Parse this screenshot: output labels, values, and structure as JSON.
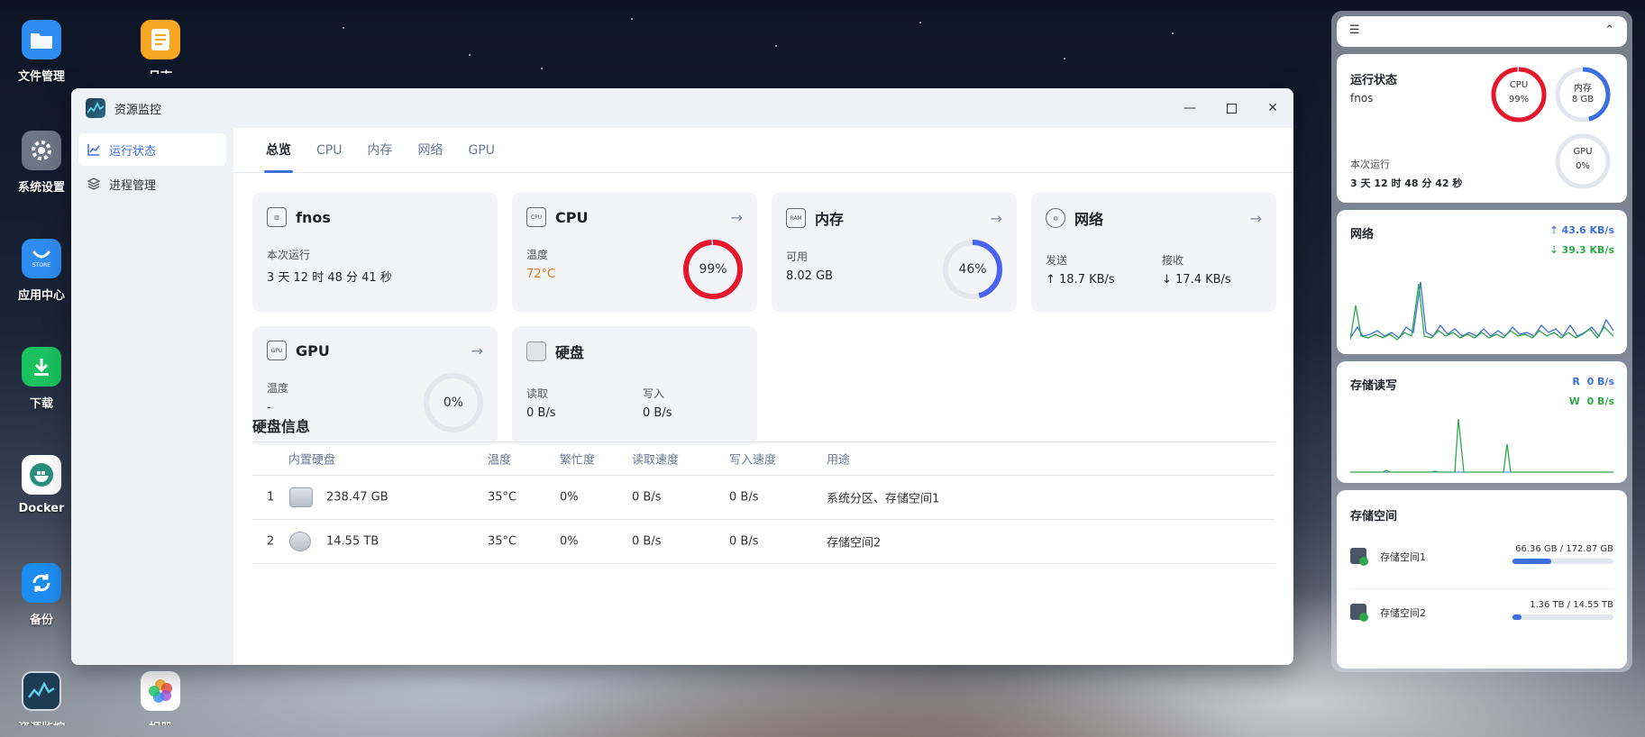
{
  "desktop": {
    "icons": [
      {
        "label": "文件管理",
        "icon": "folder-icon",
        "color": "#2f8cf0"
      },
      {
        "label": "日志",
        "icon": "log-icon",
        "color": "#f6a623"
      },
      {
        "label": "系统设置",
        "icon": "gear-icon",
        "color": "#6d7686"
      },
      {
        "label": "应用中心",
        "icon": "store-icon",
        "color": "#2f8cf0"
      },
      {
        "label": "下载",
        "icon": "download-icon",
        "color": "#19c25f"
      },
      {
        "label": "Docker",
        "icon": "docker-icon",
        "color": "#ffffff"
      },
      {
        "label": "备份",
        "icon": "backup-icon",
        "color": "#1d8cf0"
      },
      {
        "label": "资源监控",
        "icon": "monitor-icon",
        "color": "#1d3b52"
      },
      {
        "label": "相册",
        "icon": "photos-icon",
        "color": "#ffffff"
      }
    ]
  },
  "window": {
    "title": "资源监控",
    "sidebar": [
      {
        "label": "运行状态",
        "icon": "chart-line-icon",
        "active": true
      },
      {
        "label": "进程管理",
        "icon": "layers-icon",
        "active": false
      }
    ],
    "tabs": [
      "总览",
      "CPU",
      "内存",
      "网络",
      "GPU"
    ],
    "active_tab": "总览",
    "cards": {
      "host": {
        "title": "fnos",
        "uptime_label": "本次运行",
        "uptime": "3 天 12 时 48 分 41 秒"
      },
      "cpu": {
        "title": "CPU",
        "temp_label": "温度",
        "temp": "72°C",
        "usage_pct": 99,
        "usage_text": "99%",
        "temp_color": "#e8741a",
        "ring_color": "#e6162d"
      },
      "memory": {
        "title": "内存",
        "avail_label": "可用",
        "avail": "8.02 GB",
        "usage_pct": 46,
        "usage_text": "46%",
        "ring_color": "#4b64f0"
      },
      "network": {
        "title": "网络",
        "send_label": "发送",
        "send": "↑ 18.7 KB/s",
        "recv_label": "接收",
        "recv": "↓ 17.4 KB/s"
      },
      "gpu": {
        "title": "GPU",
        "temp_label": "温度",
        "temp": "-",
        "usage_pct": 0,
        "usage_text": "0%"
      },
      "disk": {
        "title": "硬盘",
        "read_label": "读取",
        "read": "0 B/s",
        "write_label": "写入",
        "write": "0 B/s"
      }
    },
    "disk_info": {
      "title": "硬盘信息",
      "columns": [
        "内置硬盘",
        "温度",
        "繁忙度",
        "读取速度",
        "写入速度",
        "用途"
      ],
      "rows": [
        {
          "index": "1",
          "size": "238.47 GB",
          "temp": "35°C",
          "busy": "0%",
          "read": "0 B/s",
          "write": "0 B/s",
          "usage": "系统分区、存储空间1"
        },
        {
          "index": "2",
          "size": "14.55 TB",
          "temp": "35°C",
          "busy": "0%",
          "read": "0 B/s",
          "write": "0 B/s",
          "usage": "存储空间2"
        }
      ]
    }
  },
  "widgets": {
    "status": {
      "title": "运行状态",
      "host": "fnos",
      "uptime_label": "本次运行",
      "uptime": "3 天 12 时 48 分 42 秒",
      "cpu": {
        "label": "CPU",
        "value": "99%",
        "pct": 99
      },
      "memory": {
        "label": "内存",
        "value": "8 GB",
        "pct": 46
      },
      "gpu": {
        "label": "GPU",
        "value": "0%",
        "pct": 0
      }
    },
    "network": {
      "title": "网络",
      "upload": "43.6 KB/s",
      "download": "39.3 KB/s",
      "upload_color": "#3b6fe0",
      "download_color": "#2ea84a"
    },
    "storage_io": {
      "title": "存储读写",
      "read_prefix": "R",
      "read": "0 B/s",
      "write_prefix": "W",
      "write": "0 B/s"
    },
    "storage_space": {
      "title": "存储空间",
      "volumes": [
        {
          "name": "存储空间1",
          "used_text": "66.36 GB / 172.87 GB",
          "fraction": 0.38
        },
        {
          "name": "存储空间2",
          "used_text": "1.36 TB / 14.55 TB",
          "fraction": 0.09
        }
      ]
    }
  }
}
